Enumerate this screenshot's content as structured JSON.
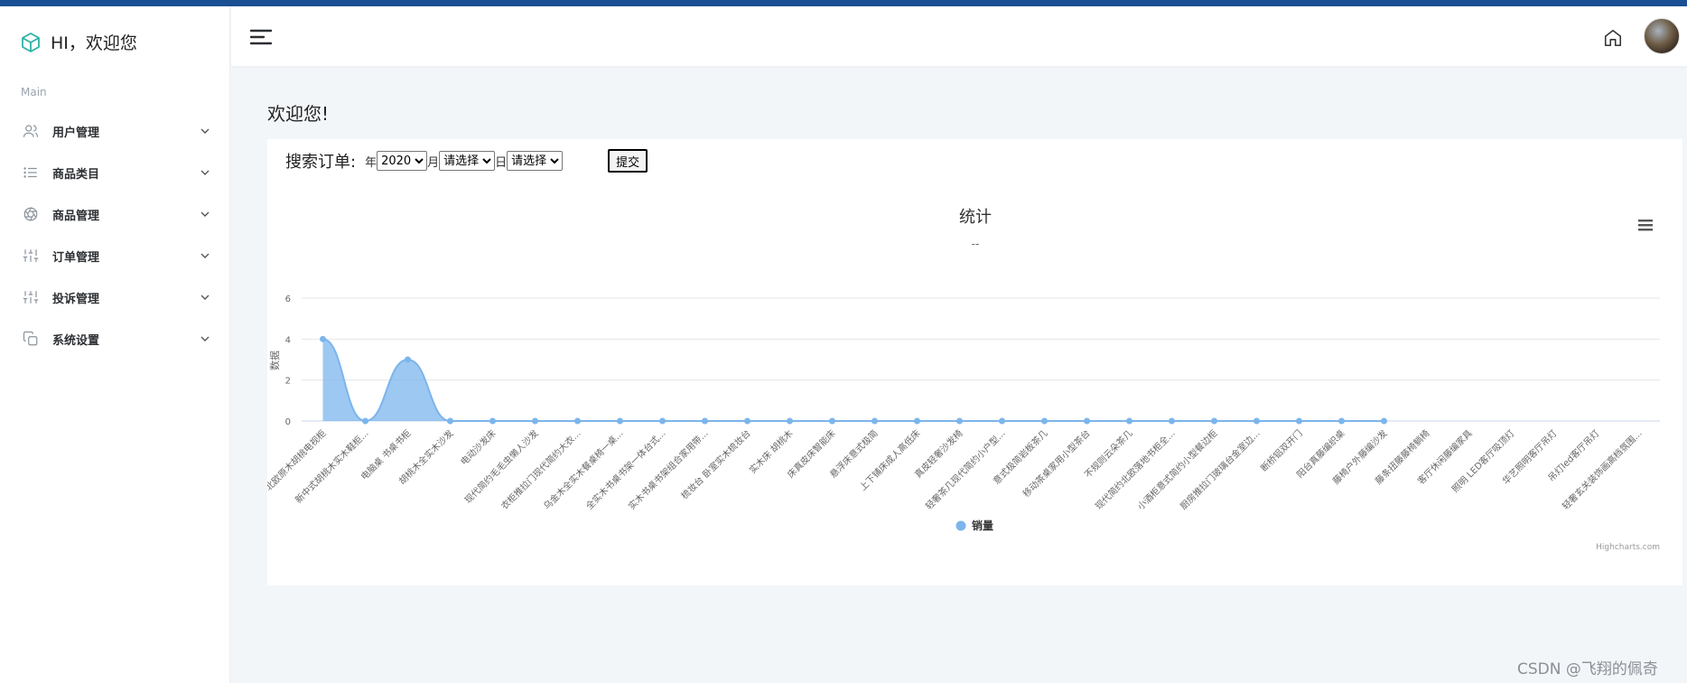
{
  "app": {
    "brand_title": "HI，欢迎您",
    "section_label": "Main",
    "accent_color": "#1b4f93",
    "brand_icon_color": "#2ab3a6"
  },
  "sidebar": {
    "items": [
      {
        "label": "用户管理",
        "icon": "users-icon"
      },
      {
        "label": "商品类目",
        "icon": "list-icon"
      },
      {
        "label": "商品管理",
        "icon": "aperture-icon"
      },
      {
        "label": "订单管理",
        "icon": "sliders-icon"
      },
      {
        "label": "投诉管理",
        "icon": "sliders-icon"
      },
      {
        "label": "系统设置",
        "icon": "copy-icon"
      }
    ]
  },
  "header": {
    "menu_icon": "hamburger-icon",
    "home_icon": "home-icon"
  },
  "main": {
    "page_title": "欢迎您!",
    "search": {
      "label": "搜索订单:",
      "year_unit": "年",
      "month_unit": "月",
      "day_unit": "日",
      "year_value": "2020",
      "month_value": "请选择",
      "day_value": "请选择",
      "submit_label": "提交"
    }
  },
  "chart_data": {
    "type": "area",
    "title": "统计",
    "subtitle": "--",
    "ylabel": "数据",
    "ylim": [
      0,
      6
    ],
    "yticks": [
      0,
      2,
      4,
      6
    ],
    "grid": true,
    "legend": "bottom-center",
    "credits": "Highcharts.com",
    "menu_icon": "context-menu-icon",
    "series_color": "#7cb5ec",
    "categories": [
      "北欧原木胡桃电视柜",
      "新中式胡桃木实木鞋柜...",
      "电脑桌 书桌书柜",
      "胡桃木全实木沙发",
      "电动沙发床",
      "现代简约毛毛虫懒人沙发",
      "衣柜推拉门现代简约大衣...",
      "乌金木全实木餐桌椅一桌...",
      "全实木书桌书架一体台式...",
      "实木书桌书架组合家用带...",
      "梳妆台 卧室实木梳妆台",
      "实木床 胡桃木",
      "床真皮床智能床",
      "悬浮床意式极简",
      "上下铺床成人高低床",
      "真皮轻奢沙发椅",
      "轻奢茶几现代简约小户型...",
      "意式极简岩板茶几",
      "移动茶桌家用小型茶台",
      "不规则云朵茶几",
      "现代简约北欧落地书柜全...",
      "小酒柜意式简约小型餐边柜",
      "厨房推拉门玻璃台金室边...",
      "断桥铝双开门",
      "阳台真藤编织桌",
      "藤椅户外藤编沙发",
      "藤条扭藤藤椅躺椅",
      "客厅休闲藤编家具",
      "照明 LED客厅吸顶灯",
      "华艺照明客厅吊灯",
      "吊灯led客厅吊灯",
      "轻奢玄关装饰画高档氛围..."
    ],
    "series": [
      {
        "name": "销量",
        "values": [
          4,
          0,
          3,
          0,
          0,
          0,
          0,
          0,
          0,
          0,
          0,
          0,
          0,
          0,
          0,
          0,
          0,
          0,
          0,
          0,
          0,
          0,
          0,
          0,
          0,
          0
        ]
      }
    ]
  },
  "watermark": "CSDN @飞翔的佩奇"
}
